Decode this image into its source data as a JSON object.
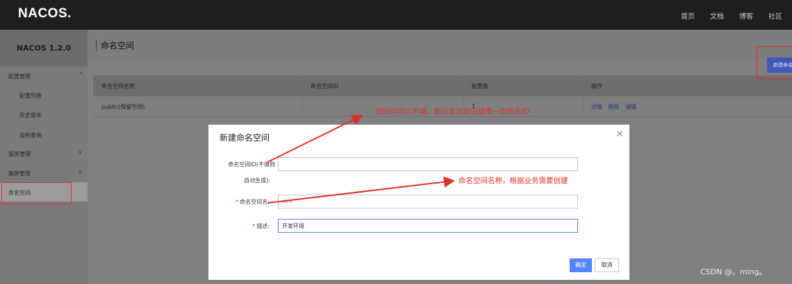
{
  "topbar": {
    "logo": "NACOS.",
    "nav": [
      "首页",
      "文档",
      "博客",
      "社区"
    ]
  },
  "sidebar": {
    "version": "NACOS 1.2.0",
    "items": [
      {
        "label": "配置管理",
        "chevron": "^"
      },
      {
        "label": "配置列表"
      },
      {
        "label": "历史版本"
      },
      {
        "label": "监听查询"
      },
      {
        "label": "服务管理",
        "chevron": "v"
      },
      {
        "label": "集群管理",
        "chevron": "v"
      },
      {
        "label": "命名空间"
      }
    ]
  },
  "page": {
    "title": "命名空间",
    "new_button": "新建命名空间"
  },
  "table": {
    "headers": [
      "命名空间名称",
      "命名空间ID",
      "配置数",
      "操作"
    ],
    "rows": [
      {
        "name": "public(保留空间)",
        "id": "",
        "count": "1",
        "ops": [
          "详情",
          "删除",
          "编辑"
        ]
      }
    ]
  },
  "dialog": {
    "title": "新建命名空间",
    "close_icon": "close-icon",
    "fields": {
      "id_label_line1": "命名空间ID(不填则",
      "id_label_line2": "自动生成):",
      "id_value": "",
      "name_label": "命名空间名:",
      "name_value": "dev",
      "desc_label": "描述:",
      "desc_value": "开发环境"
    },
    "ok": "确定",
    "cancel": "取消"
  },
  "annotations": {
    "id_note": "空间ID可以不填，默认会自动生成唯一的命名ID",
    "name_note": "命名空间名称，根据业务需要创建",
    "color": "#e0302b"
  },
  "watermark": "CSDN @。ming。"
}
